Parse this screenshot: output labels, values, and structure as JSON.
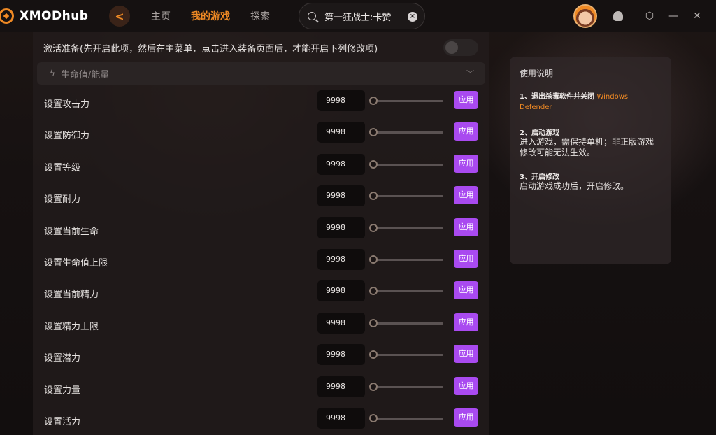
{
  "app": {
    "logo_text": "XMODhub"
  },
  "nav": {
    "back": "<",
    "items": [
      "主页",
      "我的游戏",
      "探索"
    ],
    "active_index": 1
  },
  "search": {
    "value": "第一狂战士:卡赞",
    "clear": "×"
  },
  "topbar_icons": [
    "bell-icon",
    "hex-settings-icon",
    "minimize-icon",
    "collapse-icon"
  ],
  "activate": {
    "label": "激活准备(先开启此项，然后在主菜单，点击进入装备页面后，才能开启下列修改项)",
    "enabled": false
  },
  "section": {
    "title": "生命值/能量"
  },
  "cheats": [
    {
      "label": "设置攻击力",
      "value": "9998",
      "apply": "应用"
    },
    {
      "label": "设置防御力",
      "value": "9998",
      "apply": "应用"
    },
    {
      "label": "设置等级",
      "value": "9998",
      "apply": "应用"
    },
    {
      "label": "设置耐力",
      "value": "9998",
      "apply": "应用"
    },
    {
      "label": "设置当前生命",
      "value": "9998",
      "apply": "应用"
    },
    {
      "label": "设置生命值上限",
      "value": "9998",
      "apply": "应用"
    },
    {
      "label": "设置当前精力",
      "value": "9998",
      "apply": "应用"
    },
    {
      "label": "设置精力上限",
      "value": "9998",
      "apply": "应用"
    },
    {
      "label": "设置潜力",
      "value": "9998",
      "apply": "应用"
    },
    {
      "label": "设置力量",
      "value": "9998",
      "apply": "应用"
    },
    {
      "label": "设置活力",
      "value": "9998",
      "apply": "应用"
    }
  ],
  "help": {
    "title": "使用说明",
    "step1_title": "1、退出杀毒软件并关闭",
    "step1_highlight": "Windows Defender",
    "step2_title": "2、启动游戏",
    "step2_body": "进入游戏，需保持单机；非正版游戏修改可能无法生效。",
    "step3_title": "3、开启修改",
    "step3_body": "启动游戏成功后，开启修改。"
  },
  "colors": {
    "accent": "#f08a24",
    "apply_button": "#a94af0"
  }
}
